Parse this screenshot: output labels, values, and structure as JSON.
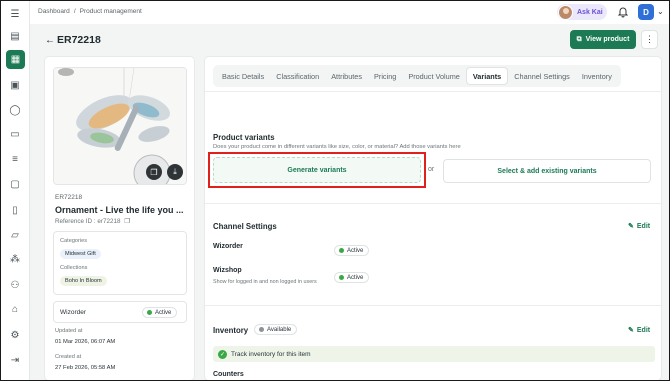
{
  "breadcrumb": {
    "root": "Dashboard",
    "sep": "/",
    "current": "Product management"
  },
  "header": {
    "ask_label": "Ask Kai",
    "user_initial": "D"
  },
  "title": "ER72218",
  "view_button": "View product",
  "product": {
    "sku": "ER72218",
    "name": "Ornament - Live the life you ...",
    "reference": "Reference ID : er72218",
    "categories_label": "Categories",
    "category": "Midwest Gift",
    "collections_label": "Collections",
    "collection": "Boho In Bloom",
    "channel_name": "Wizorder",
    "channel_status": "Active",
    "updated_label": "Updated at",
    "updated_value": "01 Mar 2026, 06:07 AM",
    "created_label": "Created at",
    "created_value": "27 Feb 2026, 05:58 AM"
  },
  "tabs": [
    "Basic Details",
    "Classification",
    "Attributes",
    "Pricing",
    "Product Volume",
    "Variants",
    "Channel Settings",
    "Inventory"
  ],
  "active_tab": "Variants",
  "variants": {
    "title": "Product variants",
    "subtitle": "Does your product come in different variants like size, color, or material? Add those variants here",
    "generate_label": "Generate variants",
    "or_label": "or",
    "select_label": "Select & add existing variants"
  },
  "channel_settings": {
    "title": "Channel Settings",
    "edit_label": "Edit",
    "rows": [
      {
        "name": "Wizorder",
        "status": "Active",
        "note": ""
      },
      {
        "name": "Wizshop",
        "status": "Active",
        "note": "Show for logged in and non logged in users"
      }
    ]
  },
  "inventory": {
    "title": "Inventory",
    "status": "Available",
    "edit_label": "Edit",
    "track_label": "Track inventory for this item",
    "counters_label": "Counters"
  },
  "colors": {
    "accent": "#1c7a54",
    "highlight": "#e0211b",
    "active_dot": "#3aa845"
  },
  "icons": [
    "menu-icon",
    "back-arrow-icon",
    "external-link-icon",
    "more-vertical-icon",
    "bell-icon",
    "copy-icon",
    "download-icon",
    "edit-icon",
    "check-icon"
  ]
}
